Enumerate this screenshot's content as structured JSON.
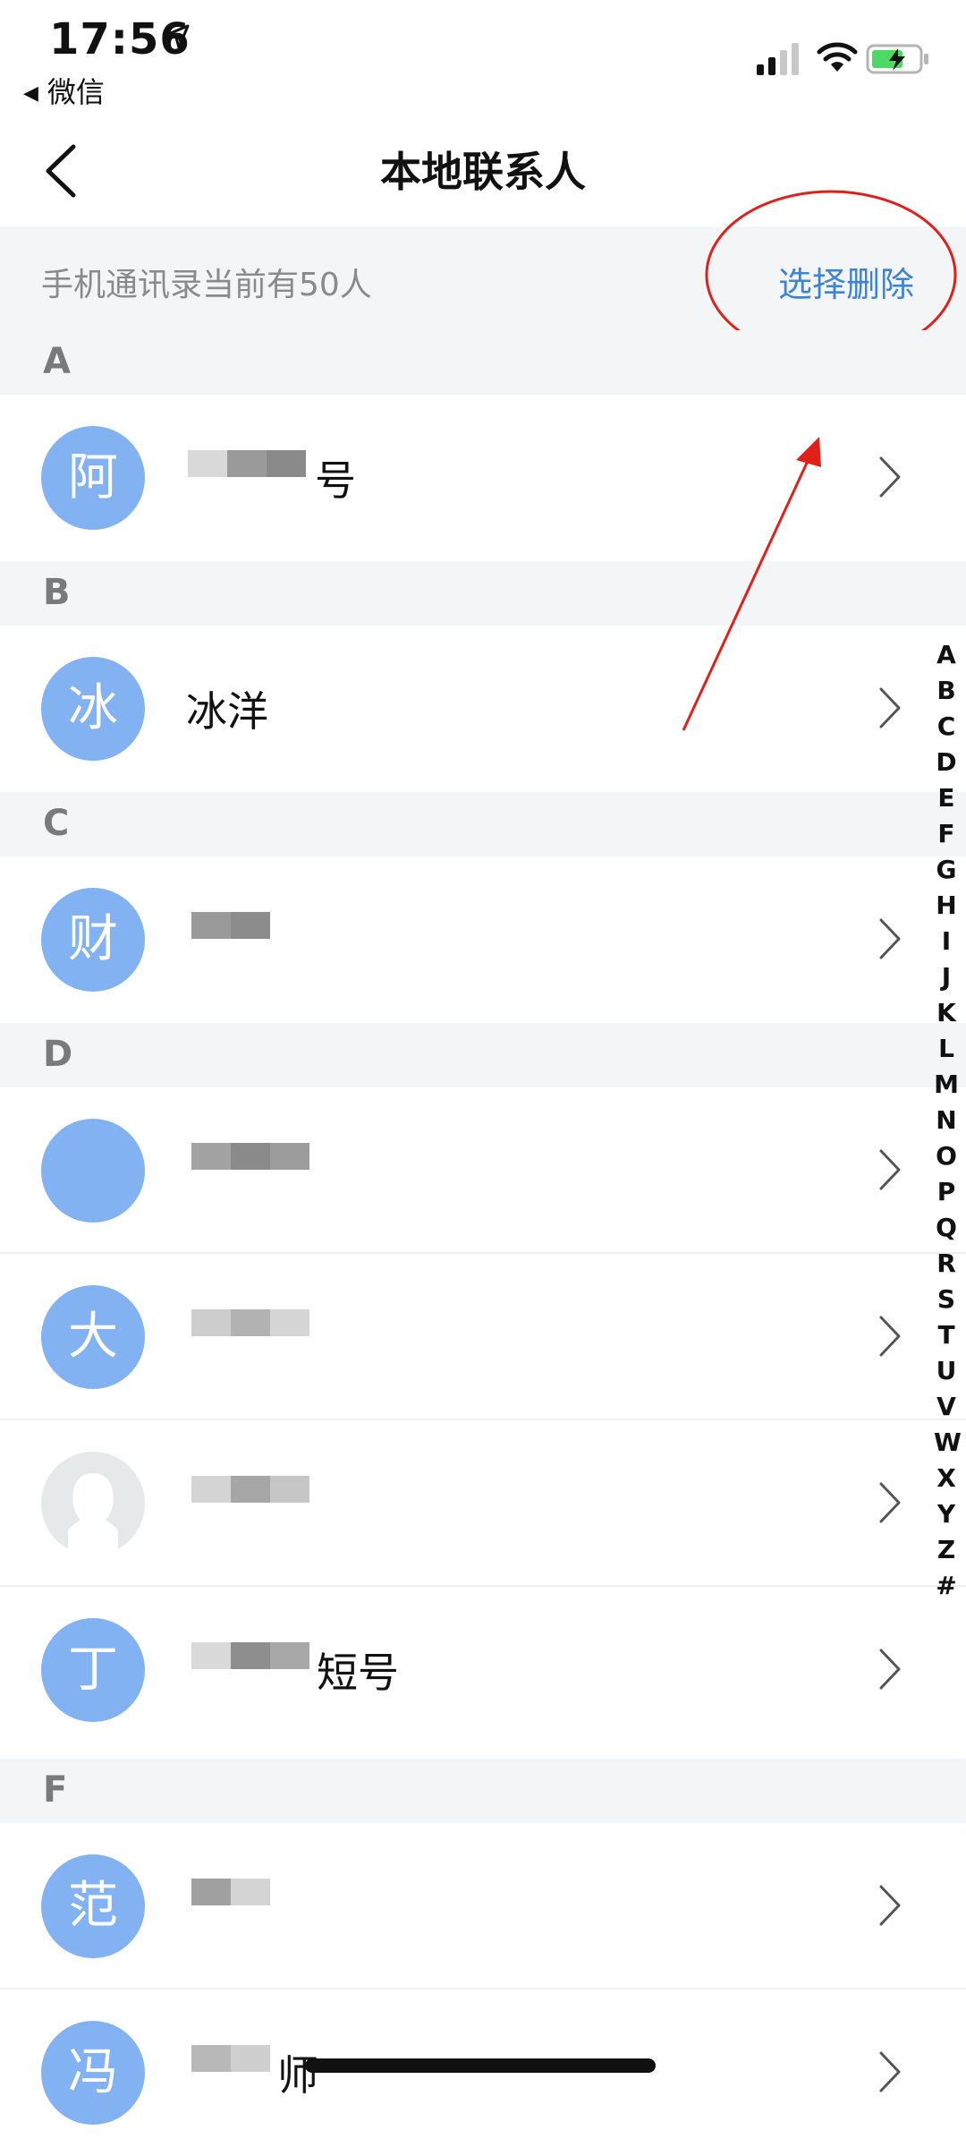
{
  "status_bar": {
    "time": "17:56",
    "back_app": "微信",
    "icons": [
      "location-arrow-icon",
      "signal-icon",
      "wifi-icon",
      "battery-charging-icon"
    ]
  },
  "nav": {
    "title": "本地联系人",
    "back_icon": "chevron-left-icon"
  },
  "summary": {
    "text": "手机通讯录当前有50人",
    "action": "选择删除",
    "action_color": "#3d83d6"
  },
  "annotation_color": "#e0201b",
  "sections": [
    {
      "letter": "A",
      "contacts": [
        {
          "avatar": "阿",
          "name_visible": "号"
        }
      ]
    },
    {
      "letter": "B",
      "contacts": [
        {
          "avatar": "冰",
          "name": "冰洋"
        }
      ]
    },
    {
      "letter": "C",
      "contacts": [
        {
          "avatar": "财",
          "name_visible": ""
        }
      ]
    },
    {
      "letter": "D",
      "contacts": [
        {
          "avatar": "",
          "name_visible": ""
        },
        {
          "avatar": "大",
          "name_visible": ""
        },
        {
          "avatar": "",
          "name_visible": ""
        },
        {
          "avatar": "丁",
          "name_visible": "短号"
        }
      ]
    },
    {
      "letter": "F",
      "contacts": [
        {
          "avatar": "范",
          "name_visible": ""
        },
        {
          "avatar": "冯",
          "name_visible": "师"
        }
      ]
    }
  ],
  "alphabet_index": [
    "A",
    "B",
    "C",
    "D",
    "E",
    "F",
    "G",
    "H",
    "I",
    "J",
    "K",
    "L",
    "M",
    "N",
    "O",
    "P",
    "Q",
    "R",
    "S",
    "T",
    "U",
    "V",
    "W",
    "X",
    "Y",
    "Z",
    "#"
  ],
  "avatar_color": "#83b2f2"
}
